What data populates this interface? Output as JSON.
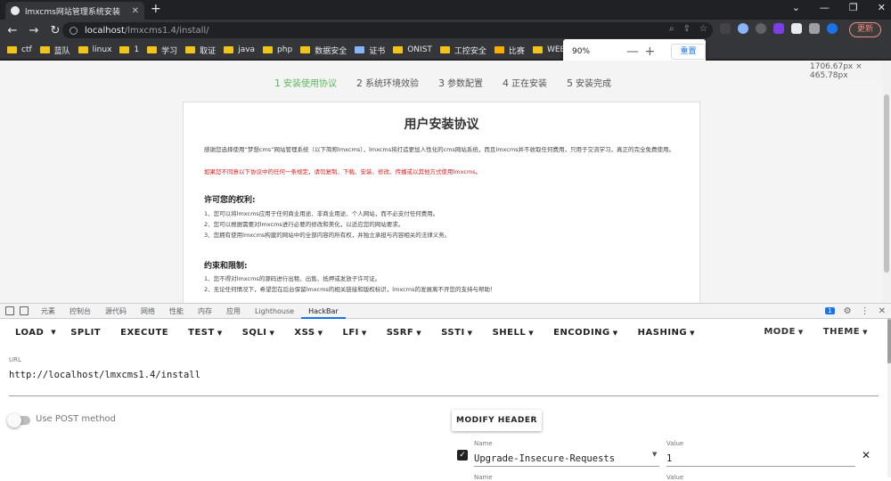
{
  "browser": {
    "tab_title": "lmxcms网站管理系统安装",
    "tab_close": "✕",
    "new_tab": "+",
    "window_controls": [
      "⌄",
      "—",
      "❐",
      "✕"
    ],
    "url_host": "localhost",
    "url_path": "/lmxcms1.4/install/",
    "update_label": "更新",
    "bookmarks": [
      "ctf",
      "蓝队",
      "linux",
      "1",
      "学习",
      "取证",
      "java",
      "php",
      "数据安全",
      "证书",
      "ONIST",
      "工控安全",
      "比赛",
      "WEB"
    ]
  },
  "zoom_popup": {
    "percent": "90%",
    "minus": "—",
    "plus": "+",
    "reset_label": "重置"
  },
  "viewport_dims": "1706.67px × 465.78px",
  "page": {
    "steps": [
      {
        "num": "1",
        "label": "安装使用协议"
      },
      {
        "num": "2",
        "label": "系统环境效验"
      },
      {
        "num": "3",
        "label": "参数配置"
      },
      {
        "num": "4",
        "label": "正在安装"
      },
      {
        "num": "5",
        "label": "安装完成"
      }
    ],
    "active_step_color": "#5cb85c",
    "title": "用户安装协议",
    "intro": "感谢您选择使用“梦想cms”网站管理系统（以下简称lmxcms），lmxcms将打造更加人性化的cms网站系统，而且lmxcms并不收取任何费用，只用于交流学习，真正的完全免费使用。",
    "warning": "如果您不同意以下协议中的任何一条规定，请勿复制、下载、安装、修改、传播或以其他方式使用lmxcms。",
    "rights_heading": "许可您的权利:",
    "rights": [
      "1、您可以将lmxcms应用于任何商业用途、非商业用途、个人网站，而不必支付任何费用。",
      "2、您可以根据需要对lmxcms进行必要的修改和美化，以适应您的网站要求。",
      "3、您拥有使用lmxcms构建的网站中的全部内容的所有权，并独立承担与内容相关的法律义务。"
    ],
    "limits_heading": "约束和限制:",
    "limits": [
      "1、您不得对lmxcms的源码进行出租、出售、抵押或发放子许可证。",
      "2、无论任何情况下，希望您在后台保留lmxcms的相关链接和版权标识，lmxcms的发展离不开您的支持与帮助！"
    ]
  },
  "devtools": {
    "tabs": [
      "元素",
      "控制台",
      "源代码",
      "网络",
      "性能",
      "内存",
      "应用",
      "Lighthouse",
      "HackBar"
    ],
    "active_tab": "HackBar",
    "issues_count": "1",
    "settings_icon": "⚙",
    "more_icon": "⋮",
    "close_icon": "✕"
  },
  "hackbar": {
    "toolbar_left": [
      {
        "label": "LOAD",
        "caret": false
      },
      {
        "label": "SPLIT",
        "caret": false
      },
      {
        "label": "EXECUTE",
        "caret": false
      },
      {
        "label": "TEST",
        "caret": true
      },
      {
        "label": "SQLI",
        "caret": true
      },
      {
        "label": "XSS",
        "caret": true
      },
      {
        "label": "LFI",
        "caret": true
      },
      {
        "label": "SSRF",
        "caret": true
      },
      {
        "label": "SSTI",
        "caret": true
      },
      {
        "label": "SHELL",
        "caret": true
      },
      {
        "label": "ENCODING",
        "caret": true
      },
      {
        "label": "HASHING",
        "caret": true
      }
    ],
    "toolbar_right": [
      "MODE",
      "THEME"
    ],
    "url_label": "URL",
    "url_value": "http://localhost/lmxcms1.4/install",
    "post_label": "Use POST method",
    "modify_header_label": "MODIFY HEADER",
    "header_name_label": "Name",
    "header_value_label": "Value",
    "header_name": "Upgrade-Insecure-Requests",
    "header_value": "1",
    "header_enabled": true
  }
}
